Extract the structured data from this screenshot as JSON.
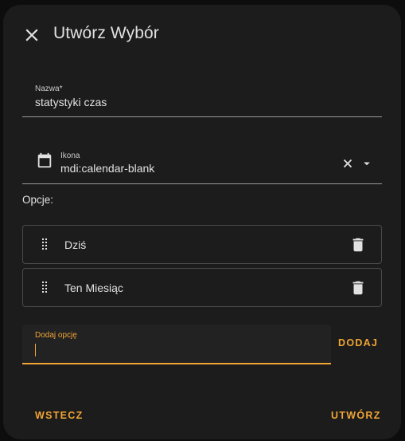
{
  "dialog": {
    "title": "Utwórz Wybór",
    "close_icon": "close-icon"
  },
  "name_field": {
    "label": "Nazwa*",
    "value": "statystyki czas"
  },
  "icon_field": {
    "label": "Ikona",
    "value": "mdi:calendar-blank",
    "leading_icon": "calendar-blank-icon",
    "clear_icon": "close-icon",
    "dropdown_icon": "menu-down-icon"
  },
  "options_section": {
    "label": "Opcje:",
    "items": [
      {
        "label": "Dziś"
      },
      {
        "label": "Ten Miesiąc"
      }
    ],
    "drag_icon": "drag-handle-icon",
    "delete_icon": "delete-icon"
  },
  "add_option": {
    "label": "Dodaj opcję",
    "value": "",
    "button_label": "DODAJ"
  },
  "footer": {
    "back_label": "WSTECZ",
    "create_label": "UTWÓRZ"
  },
  "colors": {
    "accent": "#f1a535",
    "dialog_background": "#1c1c1c",
    "text": "#e1e1e1"
  }
}
